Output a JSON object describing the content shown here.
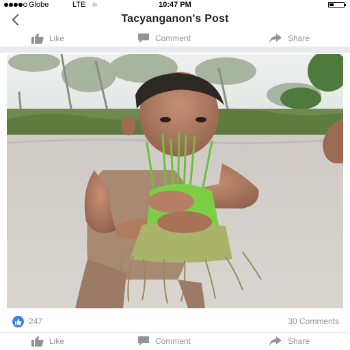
{
  "status_bar": {
    "carrier": "Globe",
    "network": "LTE",
    "time": "10:47 PM",
    "signal_bars_filled": 4,
    "signal_bars_total": 5,
    "battery_level": 0.3
  },
  "nav": {
    "title": "Tacyanganon's Post",
    "back_icon": "chevron-left-icon"
  },
  "actions_top": {
    "like": "Like",
    "comment": "Comment",
    "share": "Share"
  },
  "reactions": {
    "like_count": "247",
    "comments": "30 Comments",
    "icon": "thumbs-up-icon"
  },
  "actions_bottom": {
    "like": "Like",
    "comment": "Comment",
    "share": "Share"
  },
  "colors": {
    "muted_text": "#90949c",
    "reaction_blue": "#3b82f0",
    "divider": "#e9ebee"
  }
}
